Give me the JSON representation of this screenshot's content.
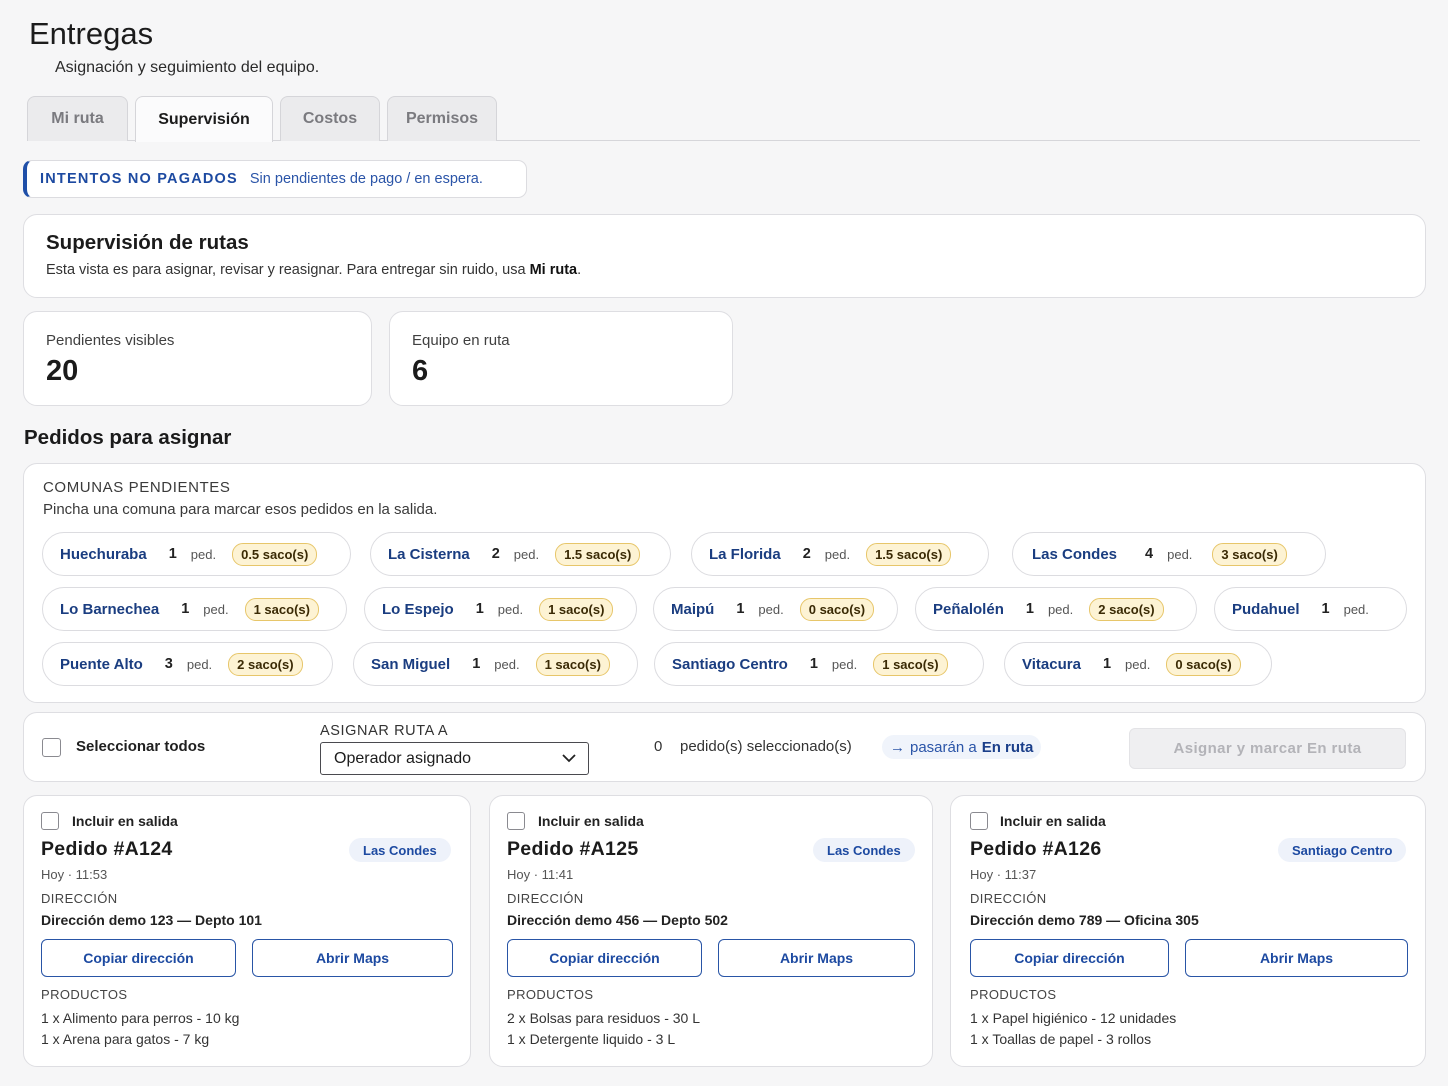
{
  "header": {
    "title": "Entregas",
    "subtitle": "Asignación y seguimiento del equipo."
  },
  "tabs": [
    {
      "label": "Mi ruta",
      "active": false
    },
    {
      "label": "Supervisión",
      "active": true
    },
    {
      "label": "Costos",
      "active": false
    },
    {
      "label": "Permisos",
      "active": false
    }
  ],
  "alert": {
    "title": "INTENTOS NO PAGADOS",
    "text": "Sin pendientes de pago / en espera."
  },
  "supervision": {
    "title": "Supervisión de rutas",
    "text": "Esta vista es para asignar, revisar y reasignar. Para entregar sin ruido, usa ",
    "link": "Mi ruta",
    "text_end": "."
  },
  "stats": [
    {
      "label": "Pendientes visibles",
      "value": "20"
    },
    {
      "label": "Equipo en ruta",
      "value": "6"
    }
  ],
  "section_title": "Pedidos para asignar",
  "comunas": {
    "heading": "COMUNAS PENDIENTES",
    "subtitle": "Pincha una comuna para marcar esos pedidos en la salida.",
    "ped_label": "ped.",
    "items": [
      {
        "name": "Huechuraba",
        "count": "1",
        "sacos": "0.5 saco(s)"
      },
      {
        "name": "La Cisterna",
        "count": "2",
        "sacos": "1.5 saco(s)"
      },
      {
        "name": "La Florida",
        "count": "2",
        "sacos": "1.5 saco(s)"
      },
      {
        "name": "Las Condes",
        "count": "4",
        "sacos": "3 saco(s)"
      },
      {
        "name": "Lo Barnechea",
        "count": "1",
        "sacos": "1 saco(s)"
      },
      {
        "name": "Lo Espejo",
        "count": "1",
        "sacos": "1 saco(s)"
      },
      {
        "name": "Maipú",
        "count": "1",
        "sacos": "0 saco(s)"
      },
      {
        "name": "Peñalolén",
        "count": "1",
        "sacos": "2 saco(s)"
      },
      {
        "name": "Pudahuel",
        "count": "1",
        "sacos": ""
      },
      {
        "name": "Puente Alto",
        "count": "3",
        "sacos": "2 saco(s)"
      },
      {
        "name": "San Miguel",
        "count": "1",
        "sacos": "1 saco(s)"
      },
      {
        "name": "Santiago Centro",
        "count": "1",
        "sacos": "1 saco(s)"
      },
      {
        "name": "Vitacura",
        "count": "1",
        "sacos": "0 saco(s)"
      }
    ]
  },
  "assign_bar": {
    "select_all": "Seleccionar todos",
    "assign_label": "ASIGNAR RUTA A",
    "select_value": "Operador asignado",
    "selected_count": "0",
    "selected_text": "pedido(s) seleccionado(s)",
    "arrow": "→",
    "to_text": "pasarán a",
    "to_status": "En ruta",
    "button": "Asignar y marcar En ruta"
  },
  "orders": [
    {
      "include": "Incluir en salida",
      "title": "Pedido #A124",
      "comuna": "Las Condes",
      "time": "Hoy · 11:53",
      "dir_label": "DIRECCIÓN",
      "address": "Dirección demo 123 — Depto 101",
      "copy_btn": "Copiar dirección",
      "maps_btn": "Abrir Maps",
      "prod_label": "PRODUCTOS",
      "products": [
        "1 x Alimento para perros - 10 kg",
        "1 x Arena para gatos - 7 kg"
      ]
    },
    {
      "include": "Incluir en salida",
      "title": "Pedido #A125",
      "comuna": "Las Condes",
      "time": "Hoy · 11:41",
      "dir_label": "DIRECCIÓN",
      "address": "Dirección demo 456 — Depto 502",
      "copy_btn": "Copiar dirección",
      "maps_btn": "Abrir Maps",
      "prod_label": "PRODUCTOS",
      "products": [
        "2 x Bolsas para residuos - 30 L",
        "1 x Detergente liquido - 3 L"
      ]
    },
    {
      "include": "Incluir en salida",
      "title": "Pedido #A126",
      "comuna": "Santiago Centro",
      "time": "Hoy · 11:37",
      "dir_label": "DIRECCIÓN",
      "address": "Dirección demo 789 — Oficina 305",
      "copy_btn": "Copiar dirección",
      "maps_btn": "Abrir Maps",
      "prod_label": "PRODUCTOS",
      "products": [
        "1 x Papel higiénico - 12 unidades",
        "1 x Toallas de papel - 3 rollos"
      ]
    }
  ]
}
